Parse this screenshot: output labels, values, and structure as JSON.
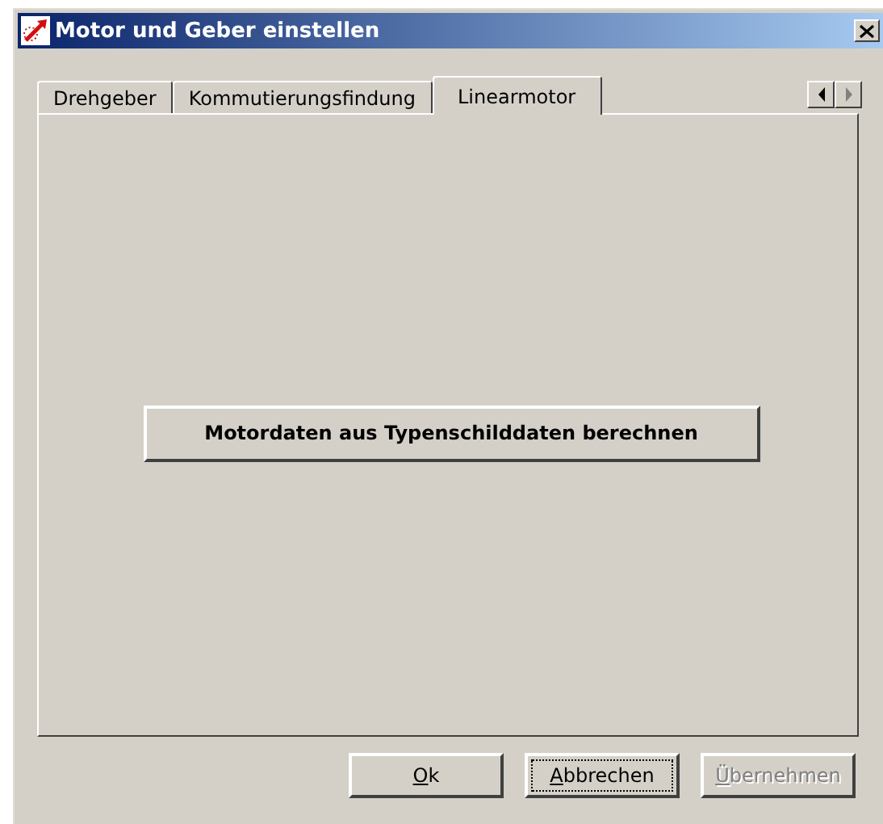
{
  "window": {
    "title": "Motor und Geber einstellen"
  },
  "tabs": [
    {
      "label": "Drehgeber",
      "selected": false
    },
    {
      "label": "Kommutierungsfindung",
      "selected": false
    },
    {
      "label": "Linearmotor",
      "selected": true
    }
  ],
  "tab_scroll": [
    {
      "kind": "left",
      "disabled": false
    },
    {
      "kind": "right",
      "disabled": true
    }
  ],
  "panel": {
    "action_button": "Motordaten aus Typenschilddaten berechnen"
  },
  "buttons": [
    {
      "label": "Ok",
      "disabled": false,
      "focused": false
    },
    {
      "label": "Abbrechen",
      "disabled": false,
      "focused": true
    },
    {
      "label": "Übernehmen",
      "disabled": true,
      "focused": false
    }
  ]
}
